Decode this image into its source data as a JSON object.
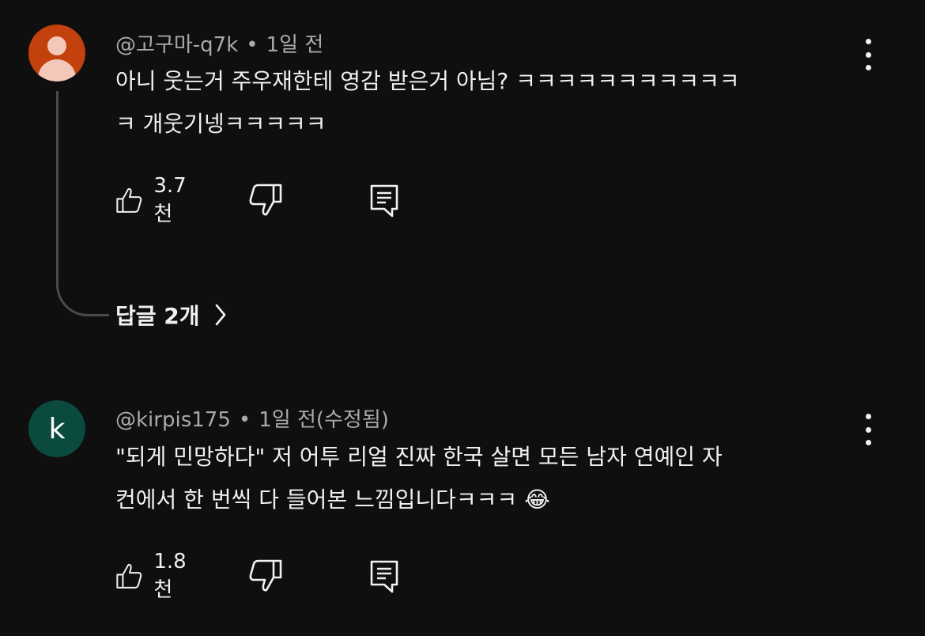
{
  "comments": [
    {
      "author": "@고구마-q7k",
      "separator": "•",
      "time": "1일 전",
      "text_lines": [
        "아니 웃는거 주우재한테 영감 받은거 아님? ㅋㅋㅋㅋㅋㅋㅋㅋㅋㅋㅋ",
        "ㅋ 개웃기넹ㅋㅋㅋㅋㅋ"
      ],
      "likes": "3.7천",
      "avatar": {
        "type": "default-person-icon",
        "color": "#c2410c"
      },
      "replies_label": "답글 2개"
    },
    {
      "author": "@kirpis175",
      "separator": "•",
      "time": "1일 전(수정됨)",
      "avatar_letter": "k",
      "text_lines": [
        "\"되게 민망하다\" 저 어투 리얼 진짜 한국 살면 모든 남자 연예인 자",
        "컨에서 한 번씩 다 들어본 느낌입니다ㅋㅋㅋ 😂"
      ],
      "likes": "1.8천",
      "avatar": {
        "type": "letter",
        "color": "#0b4a3e"
      }
    }
  ],
  "icons": [
    "thumbs-up-icon",
    "thumbs-down-icon",
    "reply-icon",
    "more-vert-icon",
    "chevron-right-icon"
  ]
}
